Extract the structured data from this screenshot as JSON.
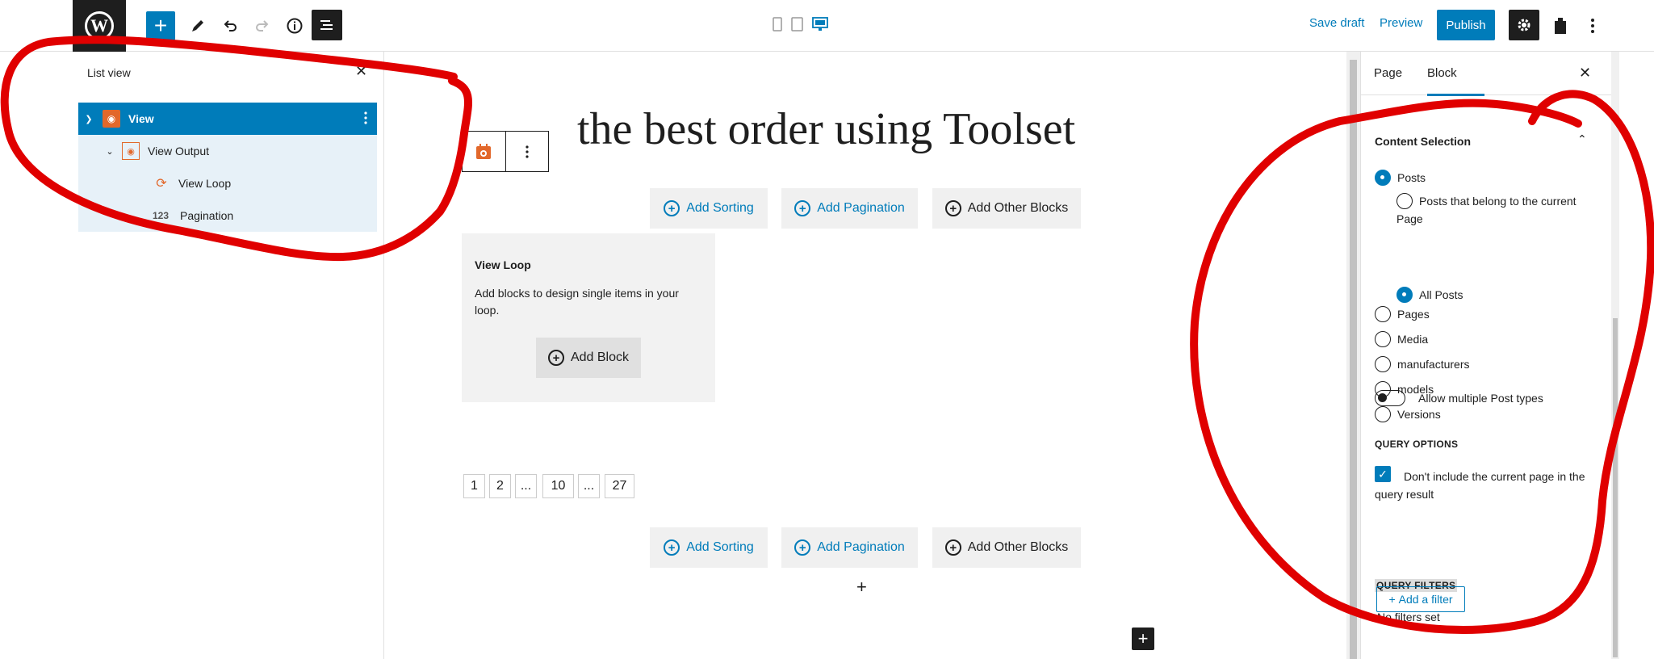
{
  "toolbar": {
    "save_draft": "Save draft",
    "preview": "Preview",
    "publish": "Publish",
    "plus_glyph": "+"
  },
  "list_view": {
    "title": "List view",
    "items": [
      {
        "label": "View"
      },
      {
        "label": "View Output"
      },
      {
        "label": "View Loop"
      },
      {
        "label": "Pagination",
        "icon_text": "123"
      }
    ]
  },
  "canvas": {
    "title": "the best order using Toolset",
    "add_sorting": "Add Sorting",
    "add_pagination": "Add Pagination",
    "add_other_blocks": "Add Other Blocks",
    "loop_heading": "View Loop",
    "loop_description": "Add blocks to design single items in your loop.",
    "add_block": "Add Block",
    "pagination": [
      "1",
      "2",
      "...",
      "10",
      "...",
      "27"
    ]
  },
  "sidebar": {
    "tabs": [
      "Page",
      "Block"
    ],
    "active_tab": "Block",
    "section_title": "Content Selection",
    "post_types": [
      {
        "label": "Posts",
        "checked": true
      },
      {
        "label": "Posts that belong to the current Page",
        "checked": false
      },
      {
        "label": "All Posts",
        "checked": true
      },
      {
        "label": "Pages",
        "checked": false
      },
      {
        "label": "Media",
        "checked": false
      },
      {
        "label": "manufacturers",
        "checked": false
      },
      {
        "label": "models",
        "checked": false
      },
      {
        "label": "Versions",
        "checked": false
      }
    ],
    "allow_multiple": "Allow multiple Post types",
    "query_options_label": "QUERY OPTIONS",
    "exclude_current": "Don't include the current page in the query result",
    "query_filters_label": "QUERY FILTERS",
    "no_filters": "No filters set",
    "add_filter": "Add a filter"
  },
  "colors": {
    "accent": "#007cba",
    "annotation": "#e00000",
    "view_block_icon": "#e2682b"
  },
  "icons": {
    "wp_logo": "wordpress-logo-icon",
    "add": "plus-icon",
    "tools": "pencil-icon",
    "undo": "undo-icon",
    "redo": "redo-icon",
    "details": "info-icon",
    "list": "list-view-icon",
    "settings": "gear-icon",
    "plugin": "puzzle-icon",
    "options": "kebab-menu-icon"
  }
}
